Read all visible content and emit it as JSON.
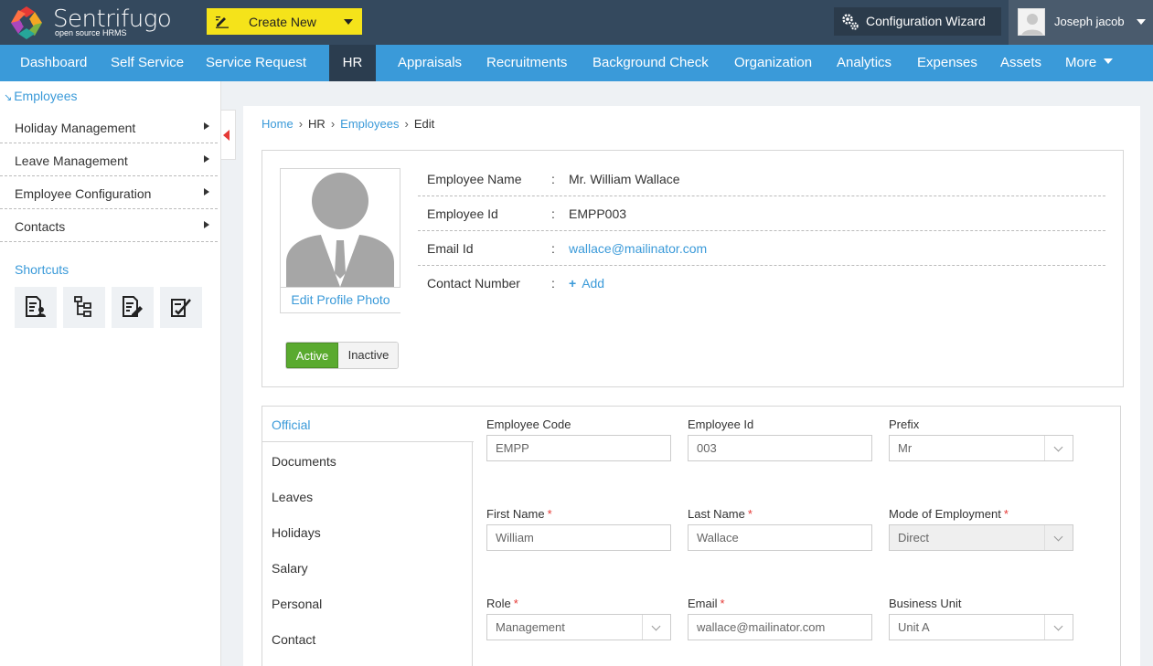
{
  "header": {
    "logo_text": "Sentrifugo",
    "logo_subtext": "open source HRMS",
    "create_new_label": "Create New",
    "wizard_label": "Configuration Wizard",
    "user_name": "Joseph jacob"
  },
  "nav": {
    "items": [
      {
        "label": "Dashboard"
      },
      {
        "label": "Self Service"
      },
      {
        "label": "Service Request"
      },
      {
        "label": "HR",
        "active": true
      },
      {
        "label": "Appraisals"
      },
      {
        "label": "Recruitments"
      },
      {
        "label": "Background Check"
      },
      {
        "label": "Organization"
      },
      {
        "label": "Analytics"
      },
      {
        "label": "Expenses"
      },
      {
        "label": "Assets"
      },
      {
        "label": "More"
      }
    ]
  },
  "sidebar": {
    "heading": "Employees",
    "items": [
      {
        "label": "Holiday Management"
      },
      {
        "label": "Leave Management"
      },
      {
        "label": "Employee Configuration"
      },
      {
        "label": "Contacts"
      }
    ],
    "shortcuts_label": "Shortcuts",
    "shortcuts": [
      "employee-list-icon",
      "org-tree-icon",
      "edit-doc-icon",
      "checklist-icon"
    ]
  },
  "breadcrumb": {
    "home": "Home",
    "hr": "HR",
    "employees": "Employees",
    "current": "Edit",
    "separator": "›"
  },
  "profile": {
    "edit_photo_label": "Edit Profile Photo",
    "status_active": "Active",
    "status_inactive": "Inactive",
    "colon": ":",
    "rows": [
      {
        "key": "Employee Name",
        "value": "Mr. William Wallace"
      },
      {
        "key": "Employee Id",
        "value": "EMPP003"
      },
      {
        "key": "Email Id",
        "value": "wallace@mailinator.com"
      },
      {
        "key": "Contact Number",
        "value": "Add"
      }
    ]
  },
  "tabs": [
    {
      "label": "Official",
      "active": true
    },
    {
      "label": "Documents"
    },
    {
      "label": "Leaves"
    },
    {
      "label": "Holidays"
    },
    {
      "label": "Salary"
    },
    {
      "label": "Personal"
    },
    {
      "label": "Contact"
    }
  ],
  "form": {
    "required_mark": "*",
    "employee_code": {
      "label": "Employee Code",
      "value": "EMPP"
    },
    "employee_id": {
      "label": "Employee Id",
      "value": "003"
    },
    "prefix": {
      "label": "Prefix",
      "value": "Mr"
    },
    "first_name": {
      "label": "First Name",
      "value": "William"
    },
    "last_name": {
      "label": "Last Name",
      "value": "Wallace"
    },
    "mode_of_employment": {
      "label": "Mode of Employment",
      "value": "Direct"
    },
    "role": {
      "label": "Role",
      "value": "Management"
    },
    "email": {
      "label": "Email",
      "value": "wallace@mailinator.com"
    },
    "business_unit": {
      "label": "Business Unit",
      "value": "Unit A"
    }
  },
  "colors": {
    "header_bg": "#34495e",
    "nav_bg": "#3a9ad9",
    "nav_active_bg": "#2b3d4f",
    "accent_yellow": "#f5e31a",
    "link_blue": "#3a9ad9",
    "active_green": "#5aaa2f",
    "required_red": "#e53935"
  }
}
